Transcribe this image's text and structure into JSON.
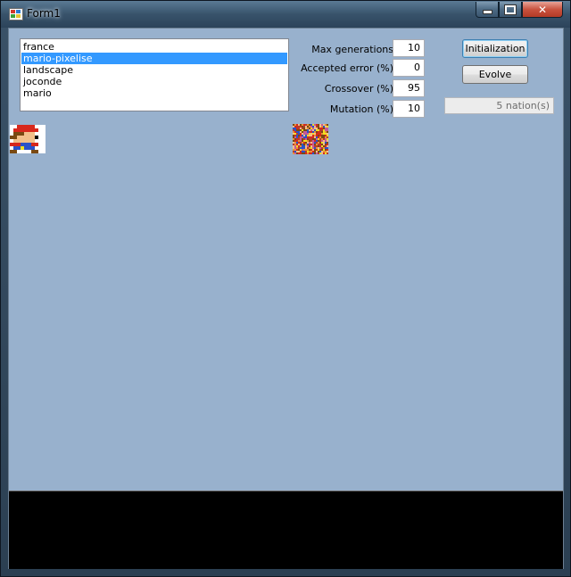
{
  "window": {
    "title": "Form1"
  },
  "images": {
    "list": [
      "france",
      "mario-pixelise",
      "landscape",
      "joconde",
      "mario"
    ],
    "selected_index": 1
  },
  "params": {
    "max_generations": {
      "label": "Max generations",
      "value": "10"
    },
    "accepted_error": {
      "label": "Accepted error (%)",
      "value": "0"
    },
    "crossover": {
      "label": "Crossover (%)",
      "value": "95"
    },
    "mutation": {
      "label": "Mutation (%)",
      "value": "10"
    }
  },
  "buttons": {
    "initialization": "Initialization",
    "evolve": "Evolve"
  },
  "status": {
    "nations": "5 nation(s)"
  },
  "colors": {
    "client_bg": "#98b1cd",
    "selection": "#3399ff",
    "console_bg": "#000000"
  }
}
